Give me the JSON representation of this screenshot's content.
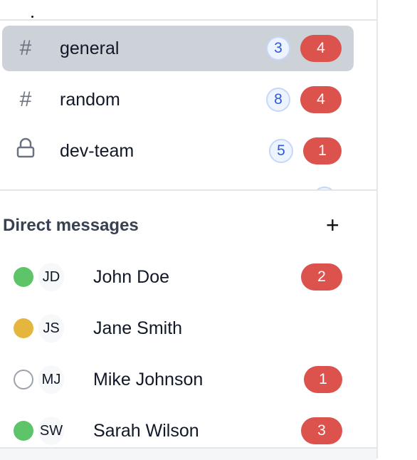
{
  "channels": [
    {
      "name": "general",
      "icon": "hash-icon",
      "glyph": "#",
      "mentions": "3",
      "unread": "4",
      "active": true
    },
    {
      "name": "random",
      "icon": "hash-icon",
      "glyph": "#",
      "mentions": "8",
      "unread": "4",
      "active": false
    },
    {
      "name": "dev-team",
      "icon": "lock-icon",
      "glyph": "",
      "mentions": "5",
      "unread": "1",
      "active": false
    }
  ],
  "direct_messages": {
    "title": "Direct messages",
    "add_glyph": "+",
    "items": [
      {
        "initials": "JD",
        "name": "John Doe",
        "status": "online",
        "unread": "2"
      },
      {
        "initials": "JS",
        "name": "Jane Smith",
        "status": "away",
        "unread": null
      },
      {
        "initials": "MJ",
        "name": "Mike Johnson",
        "status": "offline",
        "unread": "1"
      },
      {
        "initials": "SW",
        "name": "Sarah Wilson",
        "status": "online",
        "unread": "3"
      }
    ]
  },
  "colors": {
    "unread": "#dc524d",
    "mention": "#2f5bd9",
    "online": "#5dc46a",
    "away": "#e4b63d",
    "offline": "#9ca3af",
    "active_row": "#cdd1d8"
  }
}
